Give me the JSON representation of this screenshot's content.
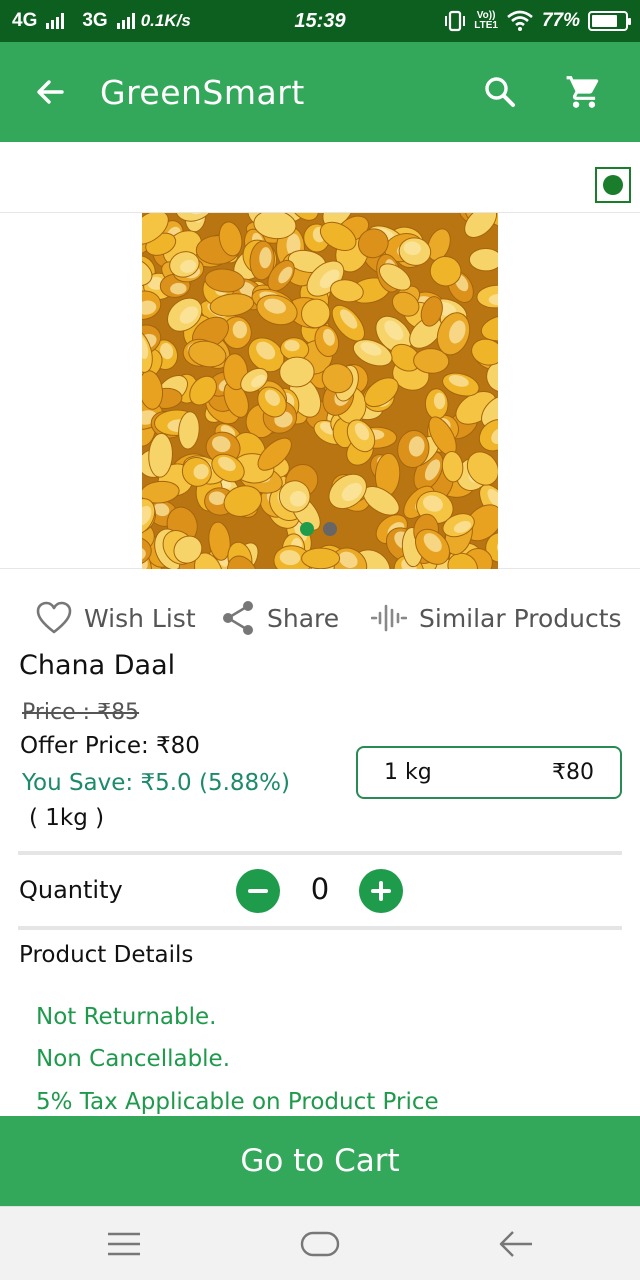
{
  "status_bar": {
    "network1": "4G",
    "network2": "3G",
    "speed": "0.1K/s",
    "time": "15:39",
    "volte": "Vo))",
    "lte": "LTE1",
    "battery": "77%",
    "battery_level": 0.77
  },
  "app_bar": {
    "title": "GreenSmart",
    "back_icon": "arrow-left-icon",
    "search_icon": "search-icon",
    "cart_icon": "shopping-cart-icon"
  },
  "gallery": {
    "image_count": 2,
    "active_index": 0,
    "dot_active_color": "#1e9c4c",
    "dot_inactive_color": "#666666"
  },
  "actions": {
    "wishlist": "Wish List",
    "share": "Share",
    "similar": "Similar Products"
  },
  "product": {
    "name": "Chana Daal",
    "mrp": "Price : ₹85",
    "offer_price": "Offer Price: ₹80",
    "you_save": "You Save: ₹5.0 (5.88%)",
    "pack": "( 1kg )"
  },
  "variant": {
    "weight": "1 kg",
    "price": "₹80"
  },
  "quantity": {
    "label": "Quantity",
    "value": "0"
  },
  "details": {
    "title": "Product Details",
    "lines": [
      "Not Returnable.",
      "Non Cancellable.",
      "5% Tax Applicable on Product Price"
    ]
  },
  "cart_button": "Go to Cart",
  "colors": {
    "primary": "#33a85a",
    "status_bar": "#0d5f1f",
    "accent_text": "#1f9a4d",
    "save_text": "#1c8a6b",
    "veg_mark": "#1a7d2b"
  }
}
